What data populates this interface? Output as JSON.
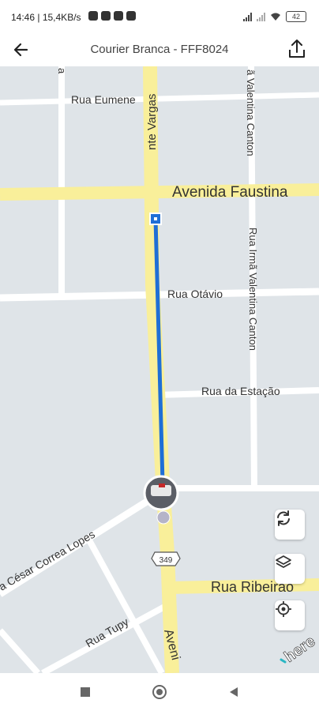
{
  "status_bar": {
    "time": "14:46",
    "speed": "15,4KB/s",
    "battery": "42"
  },
  "app_bar": {
    "title": "Courier Branca - FFF8024"
  },
  "map": {
    "streets": {
      "vargas": "nte Vargas",
      "eumene": "Rua Eumene",
      "faustina": "Avenida Faustina",
      "valentina_top": "ã Valentina Canton",
      "irma_valentina": "Rua Irmã Valentina Canton",
      "otavio": "Rua Otávio",
      "estacao": "Rua da Estação",
      "cesar": "a César Correa Lopes",
      "ribeirao": "Rua Ribeirão",
      "tupy": "Rua Tupy",
      "avenida_bottom": "Aveni",
      "route_shield": "349"
    },
    "attribution": "here",
    "colors": {
      "route": "#1f6fd6",
      "major_road": "#f9ef9a",
      "background": "#dfe4e8"
    }
  },
  "controls": {
    "refresh": "refresh-icon",
    "layers": "layers-icon",
    "locate": "locate-icon"
  }
}
